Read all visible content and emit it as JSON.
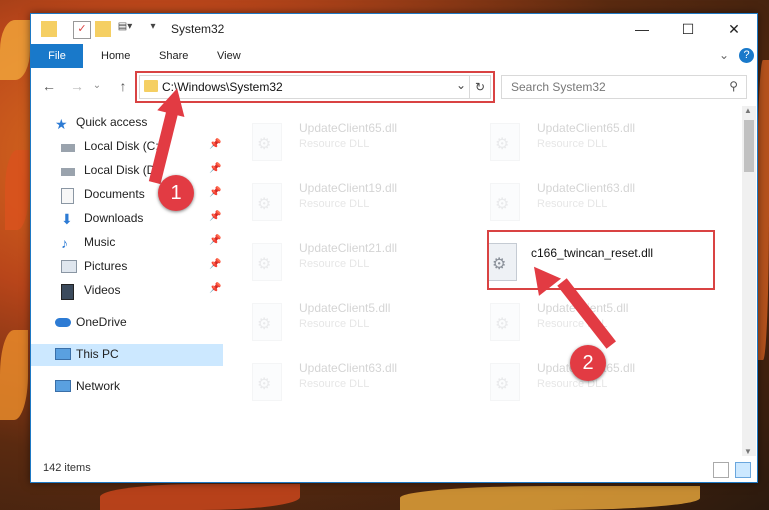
{
  "window": {
    "title": "System32",
    "controls": {
      "minimize": "—",
      "maximize": "☐",
      "close": "✕"
    }
  },
  "ribbon": {
    "file_tab": "File",
    "tabs": [
      "Home",
      "Share",
      "View"
    ],
    "expand_icon": "chevron-down-icon",
    "help_icon": "help-icon"
  },
  "address_bar": {
    "path": "C:\\Windows\\System32",
    "search_placeholder": "Search System32"
  },
  "navigation": {
    "items": [
      {
        "label": "Quick access",
        "icon": "star-icon"
      },
      {
        "label": "Local Disk (C:)",
        "icon": "drive-icon",
        "pinned": true
      },
      {
        "label": "Local Disk (D:)",
        "icon": "drive-icon",
        "pinned": true
      },
      {
        "label": "Documents",
        "icon": "documents-icon",
        "pinned": true
      },
      {
        "label": "Downloads",
        "icon": "download-icon",
        "pinned": true
      },
      {
        "label": "Music",
        "icon": "music-icon",
        "pinned": true
      },
      {
        "label": "Pictures",
        "icon": "pictures-icon",
        "pinned": true
      },
      {
        "label": "Videos",
        "icon": "videos-icon",
        "pinned": true
      },
      {
        "label": "OneDrive",
        "icon": "cloud-icon"
      },
      {
        "label": "This PC",
        "icon": "computer-icon",
        "selected": true
      },
      {
        "label": "Network",
        "icon": "network-icon"
      }
    ]
  },
  "files": [
    {
      "name": "UpdateClient65.dll",
      "type": "Resource DLL",
      "faded": true
    },
    {
      "name": "UpdateClient65.dll",
      "type": "Resource DLL",
      "faded": true
    },
    {
      "name": "UpdateClient19.dll",
      "type": "Resource DLL",
      "faded": true
    },
    {
      "name": "UpdateClient63.dll",
      "type": "Resource DLL",
      "faded": true
    },
    {
      "name": "UpdateClient21.dll",
      "type": "Resource DLL",
      "faded": true
    },
    {
      "name": "c166_twincan_reset.dll",
      "type": "",
      "faded": false
    },
    {
      "name": "UpdateClient5.dll",
      "type": "Resource DLL",
      "faded": true
    },
    {
      "name": "UpdateClient5.dll",
      "type": "Resource DLL",
      "faded": true
    },
    {
      "name": "UpdateClient63.dll",
      "type": "Resource DLL",
      "faded": true
    },
    {
      "name": "UpdateClient65.dll",
      "type": "Resource DLL",
      "faded": true
    }
  ],
  "status": {
    "item_count": "142 items"
  },
  "annotations": {
    "step1": "1",
    "step2": "2"
  },
  "colors": {
    "accent": "#1979ca",
    "annotation_red": "#e23b43"
  }
}
